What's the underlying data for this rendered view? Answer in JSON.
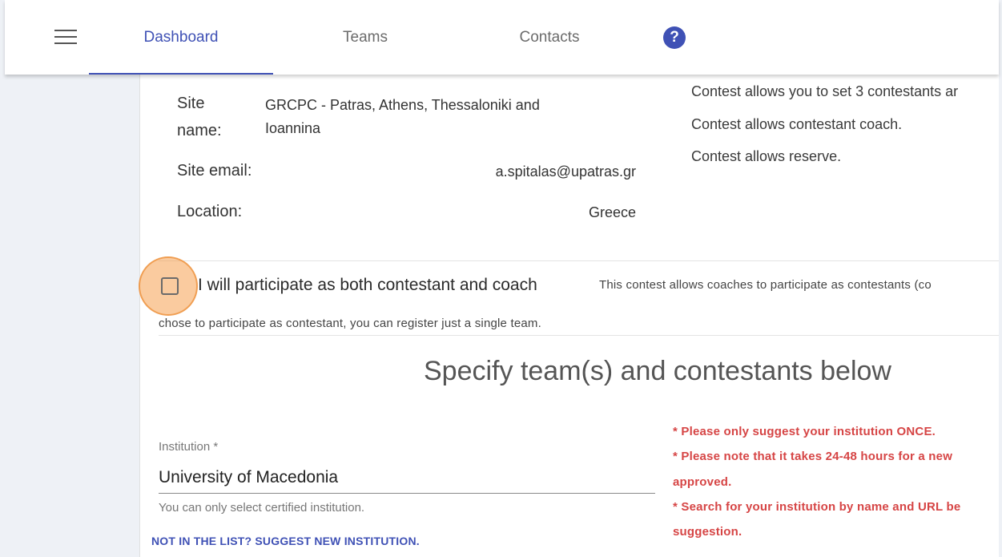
{
  "nav": {
    "tabs": [
      {
        "label": "Dashboard",
        "active": true
      },
      {
        "label": "Teams",
        "active": false
      },
      {
        "label": "Contacts",
        "active": false
      }
    ],
    "help_label": "?",
    "accent": "#3f51b5"
  },
  "site": {
    "name_label_line1": "Site",
    "name_label_line2": "name:",
    "name_value_line1": "GRCPC - Patras, Athens, Thessaloniki and",
    "name_value_line2": "Ioannina",
    "email_label": "Site email:",
    "email_value": "a.spitalas@upatras.gr",
    "location_label": "Location:",
    "location_value": "Greece"
  },
  "rules": [
    "Contest allows you to set 3 contestants ar",
    "Contest allows contestant coach.",
    "Contest allows reserve."
  ],
  "participation": {
    "checkbox_label": "I will participate as both contestant and coach",
    "checked": false,
    "note_line1": "This contest allows coaches to participate as contestants (co",
    "note_line2": "chose to participate as contestant, you can register just a single team."
  },
  "section_heading": "Specify team(s) and contestants below",
  "institution": {
    "label": "Institution *",
    "value": "University of Macedonia",
    "helper": "You can only select certified institution.",
    "suggest_link": "NOT IN THE LIST? SUGGEST NEW INSTITUTION."
  },
  "warnings": [
    "* Please only suggest your institution ONCE.",
    "* Please note that it takes 24-48 hours for a new",
    "approved.",
    "* Search for your institution by name and URL be",
    "suggestion."
  ],
  "colors": {
    "warning": "#d64545",
    "click_highlight": "#f5a050"
  }
}
